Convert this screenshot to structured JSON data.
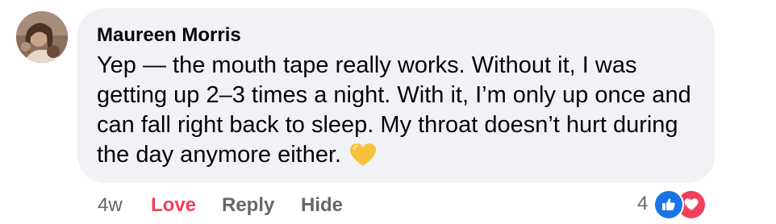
{
  "comment": {
    "author": "Maureen Morris",
    "text": "Yep — the mouth tape really works. Without it, I was getting up 2–3 times a night. With it, I’m only up once and can fall right back to sleep. My throat doesn’t hurt during the day anymore either.",
    "emoji": "yellow-heart-icon"
  },
  "actions": {
    "time": "4w",
    "love_label": "Love",
    "reply_label": "Reply",
    "hide_label": "Hide"
  },
  "reactions": {
    "count": "4",
    "types": [
      "like-reaction-icon",
      "love-reaction-icon"
    ]
  },
  "colors": {
    "bubble": "#f0f2f5",
    "love": "#f33e58",
    "like": "#1a74e8",
    "muted": "#65676b",
    "emoji_heart": "#f7c23a"
  }
}
